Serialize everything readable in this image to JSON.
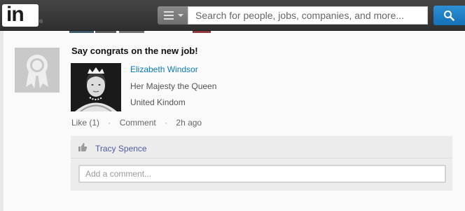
{
  "header": {
    "logo_text": "in",
    "logo_mark": "®",
    "search_placeholder": "Search for people, jobs, companies, and more...",
    "menu_icon": "hamburger-menu-icon",
    "search_icon": "magnifier-icon"
  },
  "feed_item": {
    "headline": "Say congrats on the new job!",
    "person": {
      "name": "Elizabeth Windsor",
      "title": "Her Majesty the Queen",
      "location": "United Kindom"
    },
    "actions": {
      "like": "Like (1)",
      "separator": "·",
      "comment": "Comment",
      "time": "2h ago"
    },
    "likers": "Tracy Spence",
    "comment_placeholder": "Add a comment..."
  },
  "colors": {
    "brand_blue": "#1570b8",
    "link_blue": "#0a7bba",
    "liker_blue": "#4f5aa6"
  }
}
